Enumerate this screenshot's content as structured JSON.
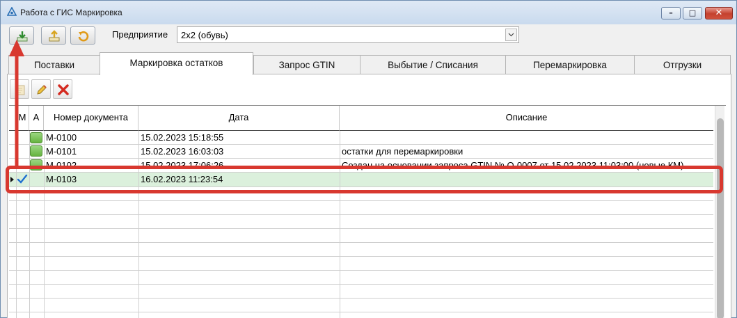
{
  "window": {
    "title": "Работа с ГИС Маркировка",
    "controls": {
      "minimize": "–",
      "maximize": "□",
      "close": "✕"
    }
  },
  "toolbar": {
    "buttons": [
      {
        "name": "download-icon",
        "color": "#4caf50"
      },
      {
        "name": "upload-icon",
        "color": "#e0c040"
      },
      {
        "name": "refresh-icon",
        "color": "#e2a020"
      }
    ],
    "enterprise_label": "Предприятие",
    "enterprise_value": "2x2 (обувь)"
  },
  "tabs": [
    {
      "label": "Поставки",
      "active": false
    },
    {
      "label": "Маркировка остатков",
      "active": true
    },
    {
      "label": "Запрос GTIN",
      "active": false
    },
    {
      "label": "Выбытие / Списания",
      "active": false
    },
    {
      "label": "Перемаркировка",
      "active": false
    },
    {
      "label": "Отгрузки",
      "active": false
    }
  ],
  "subtoolbar": [
    "add-document-icon",
    "edit-pencil-icon",
    "delete-x-icon"
  ],
  "grid": {
    "columns": [
      "М",
      "А",
      "Номер документа",
      "Дата",
      "Описание"
    ],
    "rows": [
      {
        "number": "М-0100",
        "date": "15.02.2023 15:18:55",
        "description": "",
        "status": true,
        "checked": false,
        "selected": false
      },
      {
        "number": "М-0101",
        "date": "15.02.2023 16:03:03",
        "description": "остатки для перемаркировки",
        "status": true,
        "checked": false,
        "selected": false
      },
      {
        "number": "М-0102",
        "date": "15.02.2023 17:06:26",
        "description": "Создан на основании запроса GTIN № О-0007 от 15.02.2023 11:03:00 (новые КМ)",
        "status": true,
        "checked": false,
        "selected": false
      },
      {
        "number": "М-0103",
        "date": "16.02.2023 11:23:54",
        "description": "",
        "status": false,
        "checked": true,
        "selected": true
      }
    ]
  },
  "colors": {
    "accent": "#d8382f",
    "selection": "#dbf0dc",
    "status_green": "#7cc35b"
  }
}
